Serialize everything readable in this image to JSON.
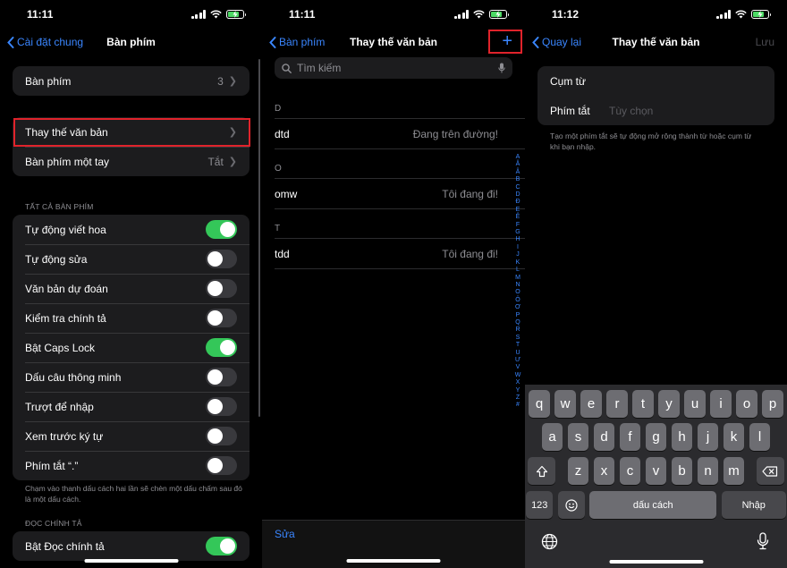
{
  "screen1": {
    "time": "11:11",
    "back_label": "Cài đặt chung",
    "title": "Bàn phím",
    "keyboards": {
      "label": "Bàn phím",
      "value": "3"
    },
    "text_replacement": "Thay thế văn bản",
    "one_handed": {
      "label": "Bàn phím một tay",
      "value": "Tắt"
    },
    "section_all": "TẤT CẢ BÀN PHÍM",
    "toggles": [
      {
        "label": "Tự động viết hoa",
        "on": true
      },
      {
        "label": "Tự động sửa",
        "on": false
      },
      {
        "label": "Văn bản dự đoán",
        "on": false
      },
      {
        "label": "Kiểm tra chính tả",
        "on": false
      },
      {
        "label": "Bật Caps Lock",
        "on": true
      },
      {
        "label": "Dấu câu thông minh",
        "on": false
      },
      {
        "label": "Trượt để nhập",
        "on": false
      },
      {
        "label": "Xem trước ký tự",
        "on": false
      },
      {
        "label": "Phím tắt “.”",
        "on": false
      }
    ],
    "period_note": "Chạm vào thanh dấu cách hai lần sẽ chèn một dấu chấm sau đó là một dấu cách.",
    "section_dictation": "ĐỌC CHÍNH TẢ",
    "dictation": {
      "label": "Bật Đọc chính tả",
      "on": true
    }
  },
  "screen2": {
    "time": "11:11",
    "back_label": "Bàn phím",
    "title": "Thay thế văn bản",
    "add_symbol": "+",
    "search_placeholder": "Tìm kiếm",
    "sections": [
      {
        "header": "D",
        "items": [
          {
            "shortcut": "dtd",
            "phrase": "Đang trên đường!"
          }
        ]
      },
      {
        "header": "O",
        "items": [
          {
            "shortcut": "omw",
            "phrase": "Tôi đang đi!"
          }
        ]
      },
      {
        "header": "T",
        "items": [
          {
            "shortcut": "tdd",
            "phrase": "Tôi đang đi!"
          }
        ]
      }
    ],
    "index_letters": [
      "A",
      "Ă",
      "Â",
      "B",
      "C",
      "D",
      "Đ",
      "E",
      "Ê",
      "F",
      "G",
      "H",
      "I",
      "J",
      "K",
      "L",
      "M",
      "N",
      "O",
      "Ô",
      "Ơ",
      "P",
      "Q",
      "R",
      "S",
      "T",
      "U",
      "Ư",
      "V",
      "W",
      "X",
      "Y",
      "Z",
      "#"
    ],
    "edit_label": "Sửa"
  },
  "screen3": {
    "time": "11:12",
    "back_label": "Quay lại",
    "title": "Thay thế văn bản",
    "save_label": "Lưu",
    "phrase_label": "Cụm từ",
    "shortcut_label": "Phím tắt",
    "shortcut_placeholder": "Tùy chọn",
    "hint": "Tạo một phím tắt sẽ tự động mở rộng thành từ hoặc cụm từ khi bạn nhập.",
    "keyboard": {
      "row1": [
        "q",
        "w",
        "e",
        "r",
        "t",
        "y",
        "u",
        "i",
        "o",
        "p"
      ],
      "row2": [
        "a",
        "s",
        "d",
        "f",
        "g",
        "h",
        "j",
        "k",
        "l"
      ],
      "row3": [
        "z",
        "x",
        "c",
        "v",
        "b",
        "n",
        "m"
      ],
      "numbers_key": "123",
      "space_key": "dấu cách",
      "return_key": "Nhập"
    }
  },
  "colors": {
    "accent": "#3a86ff",
    "toggle_on": "#34c759",
    "highlight": "#e0232b"
  }
}
